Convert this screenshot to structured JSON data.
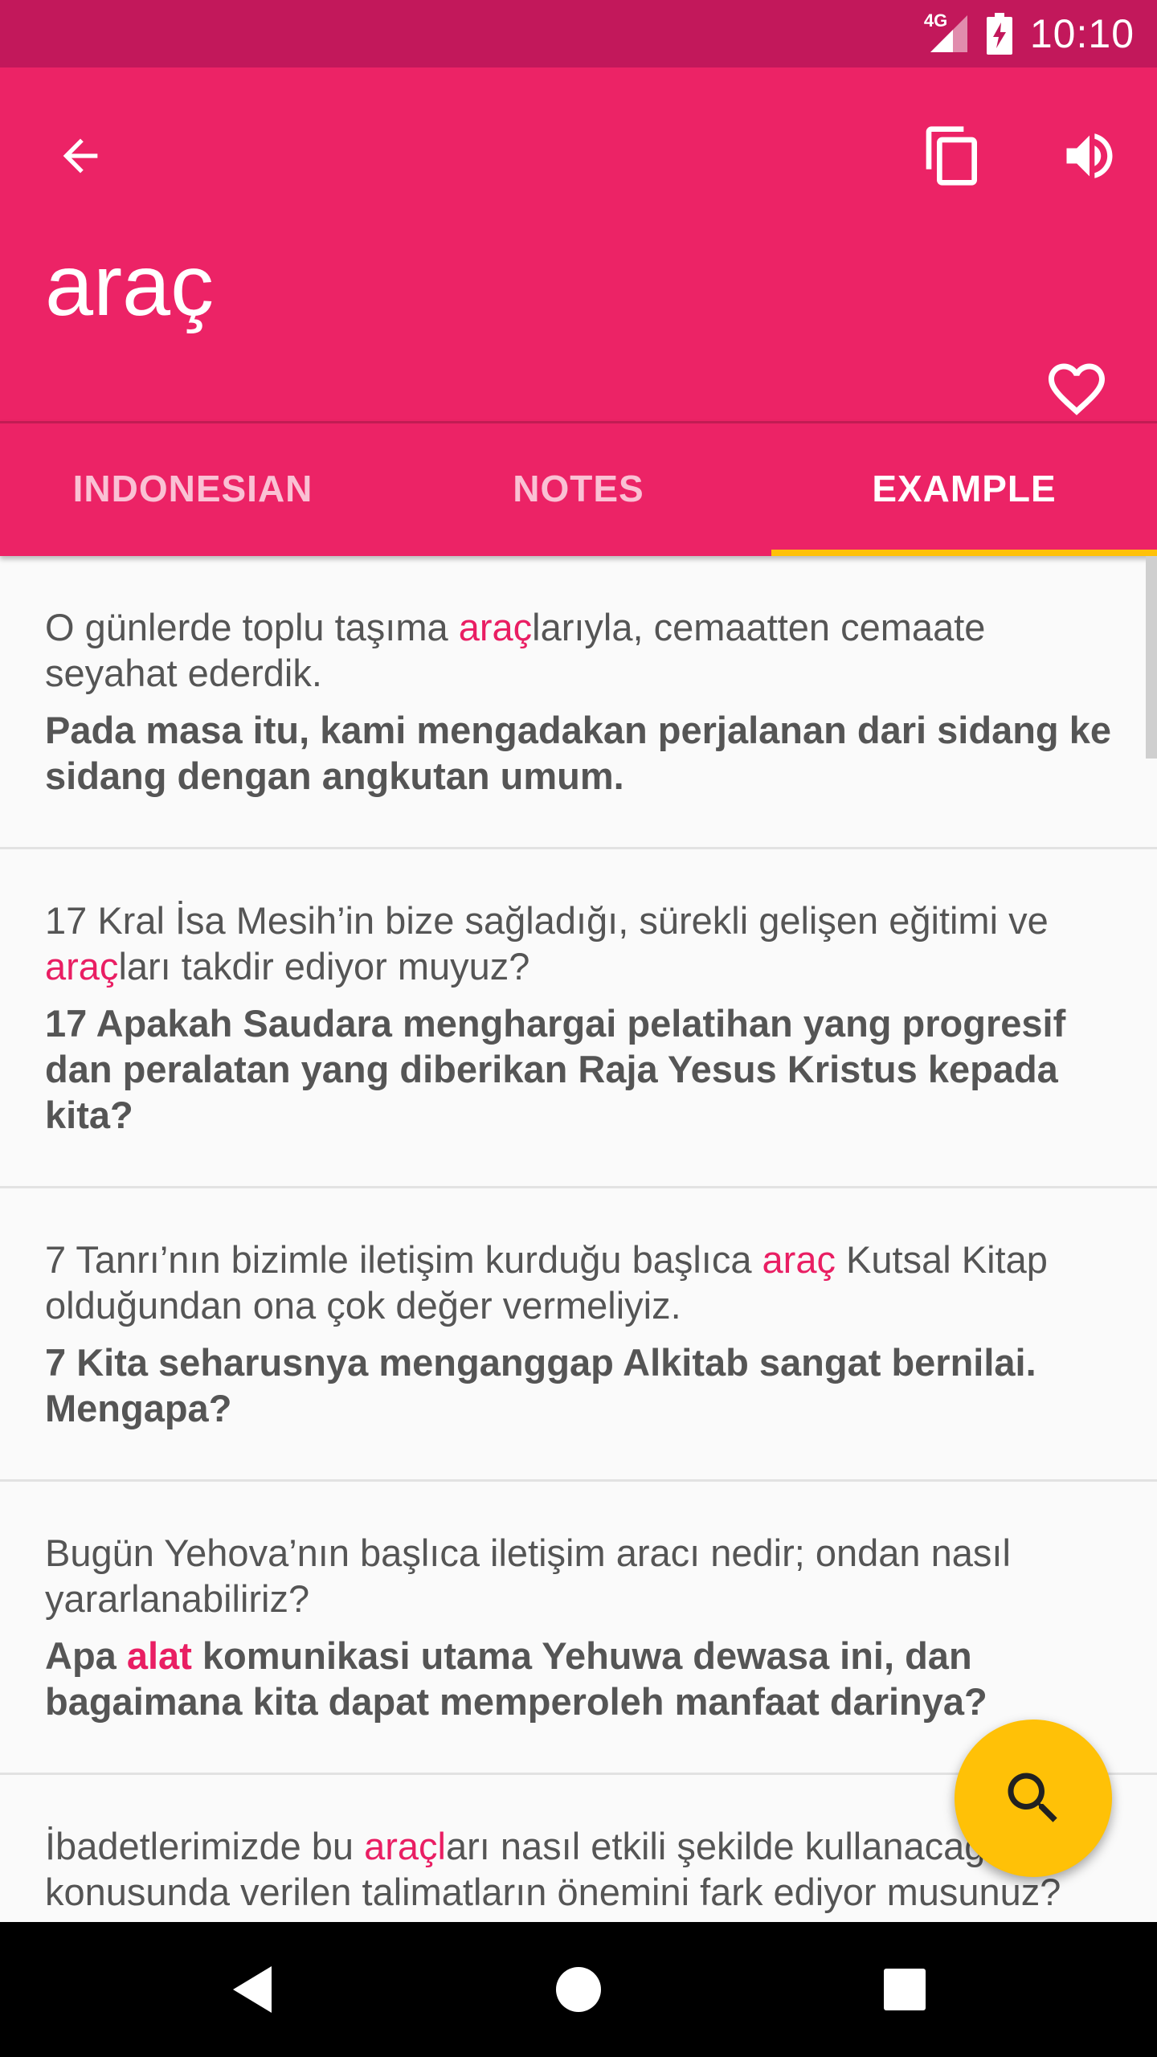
{
  "status_bar": {
    "network": "4G",
    "time": "10:10"
  },
  "app_bar": {
    "back_icon": "arrow-back-icon",
    "copy_icon": "content-copy-icon",
    "sound_icon": "volume-up-icon",
    "favorite_icon": "heart-outline-icon",
    "word": "araç"
  },
  "tabs": [
    {
      "label": "INDONESIAN",
      "active": false
    },
    {
      "label": "NOTES",
      "active": false
    },
    {
      "label": "EXAMPLE",
      "active": true
    }
  ],
  "examples": [
    {
      "src_parts": [
        "O günlerde toplu taşıma ",
        "araç",
        "larıyla, cemaatten cemaate seyahat ederdik."
      ],
      "tgt_parts": [
        "Pada masa itu, kami mengadakan perjalanan dari sidang ke sidang dengan angkutan umum.",
        "",
        ""
      ]
    },
    {
      "src_parts": [
        "17 Kral İsa Mesih’in bize sağladığı, sürekli gelişen eğitimi ve ",
        "araç",
        "ları takdir ediyor muyuz?"
      ],
      "tgt_parts": [
        "17 Apakah Saudara menghargai pelatihan yang progresif dan peralatan yang diberikan Raja Yesus Kristus kepada kita?",
        "",
        ""
      ]
    },
    {
      "src_parts": [
        "7 Tanrı’nın bizimle iletişim kurduğu başlıca ",
        "araç",
        " Kutsal Kitap olduğundan ona çok değer vermeliyiz."
      ],
      "tgt_parts": [
        "7 Kita seharusnya menganggap Alkitab sangat bernilai. Mengapa?",
        "",
        ""
      ]
    },
    {
      "src_parts": [
        "Bugün Yehova’nın başlıca iletişim aracı nedir; ondan nasıl yararlanabiliriz?",
        "",
        ""
      ],
      "tgt_parts": [
        "Apa ",
        "alat",
        " komunikasi utama Yehuwa dewasa ini, dan bagaimana kita dapat memperoleh manfaat darinya?"
      ]
    },
    {
      "src_parts": [
        "İbadetlerimizde bu ",
        "araçl",
        "arı nasıl etkili şekilde kullanacağımız konusunda verilen talimatların önemini fark ediyor musunuz?"
      ],
      "tgt_parts": [
        "",
        "",
        ""
      ]
    }
  ],
  "fab": {
    "icon": "search-icon"
  },
  "nav_bar": {
    "back_icon": "nav-back-triangle-icon",
    "home_icon": "nav-home-circle-icon",
    "recents_icon": "nav-recents-square-icon"
  },
  "colors": {
    "status_bar": "#c2185b",
    "primary": "#ec2366",
    "accent": "#ffc107",
    "highlight": "#e91e63"
  }
}
